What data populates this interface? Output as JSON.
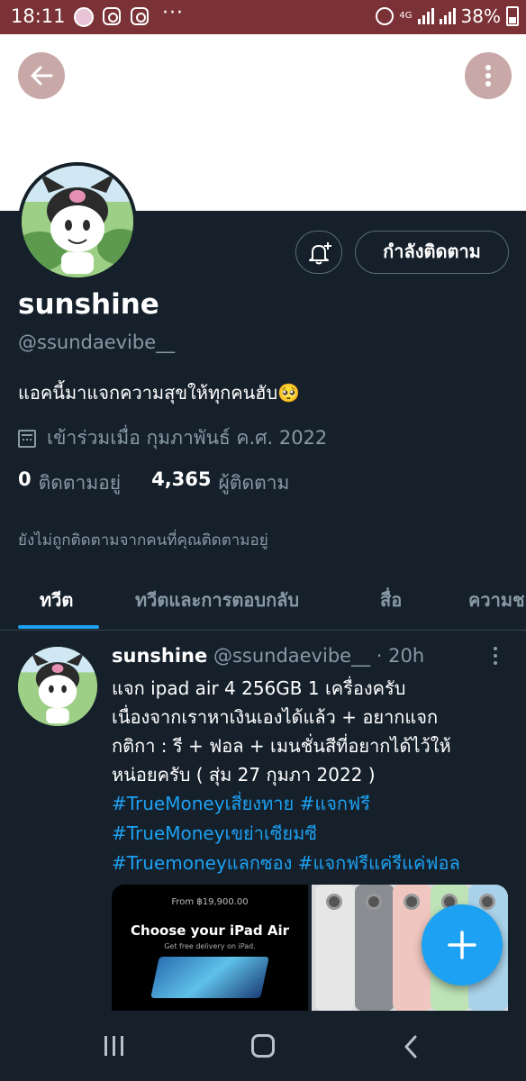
{
  "status_bar": {
    "time": "18:11",
    "dots": "···",
    "network": "4G",
    "battery": "38%"
  },
  "profile": {
    "name": "sunshine",
    "handle": "@ssundaevibe__",
    "bio": "แอคนี้มาแจกความสุขให้ทุกคนฮับ🥺",
    "joined": "เข้าร่วมเมื่อ กุมภาพันธ์ ค.ศ. 2022",
    "following_count": "0",
    "following_label": "ติดตามอยู่",
    "followers_count": "4,365",
    "followers_label": "ผู้ติดตาม",
    "not_followed_note": "ยังไม่ถูกติดตามจากคนที่คุณติดตามอยู่",
    "follow_button": "กำลังติดตาม"
  },
  "tabs": [
    {
      "label": "ทวีต",
      "active": true
    },
    {
      "label": "ทวีตและการตอบกลับ",
      "active": false
    },
    {
      "label": "สื่อ",
      "active": false
    },
    {
      "label": "ความชอ",
      "active": false
    }
  ],
  "tweet": {
    "name": "sunshine",
    "meta": "@ssundaevibe__ · 20h",
    "lines": [
      "แจก ipad air 4 256GB 1 เครื่องครับ",
      "เนื่องจากเราหาเงินเองได้แล้ว + อยากแจก",
      "กติกา : รี + ฟอล + เมนชั่นสีที่อยากได้ไว้ให้",
      "หน่อยครับ ( สุ่ม 27 กุมภา 2022 )"
    ],
    "hashtags": [
      " #TrueMoneyเสี่ยงทาย #แจกฟรี",
      "#TrueMoneyเขย่าเซียมซี",
      "#Truemoneyแลกซอง #แจกฟรีแค่รีแค่ฟอล"
    ],
    "media": {
      "price": "From ฿19,900.00",
      "headline": "Choose your iPad Air",
      "sub": "Get free delivery on iPad."
    }
  },
  "colors": {
    "background": "#15202b",
    "accent": "#1da1f2",
    "status_bar": "#7a3236",
    "muted_text": "#8899a6"
  },
  "icons": [
    "back-arrow-icon",
    "more-vertical-icon",
    "bell-plus-icon",
    "calendar-icon",
    "compose-plus-icon",
    "recent-apps-icon",
    "home-icon",
    "nav-back-icon"
  ]
}
